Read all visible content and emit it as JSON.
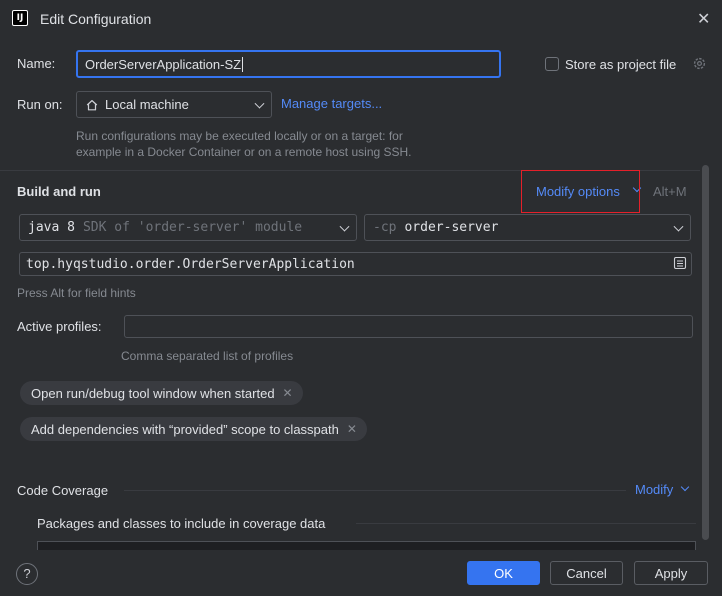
{
  "window": {
    "title": "Edit Configuration",
    "app_icon_text": "IJ"
  },
  "name_row": {
    "label": "Name:",
    "value": "OrderServerApplication-SZ",
    "store_label": "Store as project file"
  },
  "run_on": {
    "label": "Run on:",
    "value": "Local machine",
    "manage_link": "Manage targets...",
    "hint_line1": "Run configurations may be executed locally or on a target: for",
    "hint_line2": "example in a Docker Container or on a remote host using SSH."
  },
  "build_run": {
    "title": "Build and run",
    "modify_options": "Modify options",
    "shortcut": "Alt+M",
    "jdk_name": "java 8",
    "jdk_detail": "SDK of 'order-server' module",
    "cp_prefix": "-cp",
    "cp_value": "order-server",
    "main_class": "top.hyqstudio.order.OrderServerApplication",
    "field_hint": "Press Alt for field hints"
  },
  "profiles": {
    "label": "Active profiles:",
    "value": "",
    "hint": "Comma separated list of profiles"
  },
  "chips": [
    {
      "label": "Open run/debug tool window when started"
    },
    {
      "label": "Add dependencies with “provided” scope to classpath"
    }
  ],
  "coverage": {
    "title": "Code Coverage",
    "modify": "Modify",
    "include_label": "Packages and classes to include in coverage data"
  },
  "footer": {
    "help": "?",
    "ok": "OK",
    "cancel": "Cancel",
    "apply": "Apply"
  },
  "colors": {
    "accent": "#3574f0",
    "link": "#548af7",
    "highlight_box": "#e5202a",
    "background": "#2b2d30"
  }
}
